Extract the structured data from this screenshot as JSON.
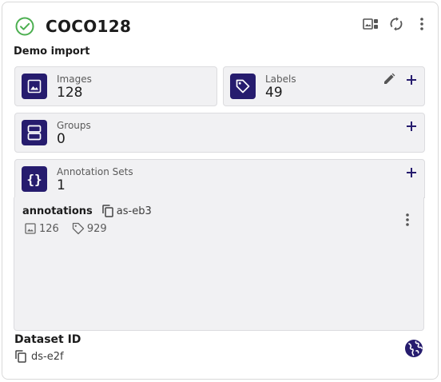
{
  "dataset": {
    "name": "COCO128",
    "description": "Demo import",
    "status_icon": "check-circle-icon"
  },
  "toolbar": {
    "icons": [
      "image-gallery-icon",
      "sync-icon",
      "more-vert-icon"
    ]
  },
  "tiles": {
    "images": {
      "label": "Images",
      "value": "128",
      "icon": "image-icon"
    },
    "labels": {
      "label": "Labels",
      "value": "49",
      "icon": "tag-icon"
    },
    "groups": {
      "label": "Groups",
      "value": "0",
      "icon": "groups-icon"
    },
    "annotation_sets": {
      "label": "Annotation Sets",
      "value": "1",
      "icon": "braces-icon"
    }
  },
  "annotation_set": {
    "name": "annotations",
    "id": "as-eb3",
    "image_count": "126",
    "label_count": "929"
  },
  "dataset_id": {
    "label": "Dataset ID",
    "value": "ds-e2f"
  },
  "colors": {
    "accent": "#261c6e",
    "success": "#4caf50",
    "tile_bg": "#f1f1f3"
  }
}
